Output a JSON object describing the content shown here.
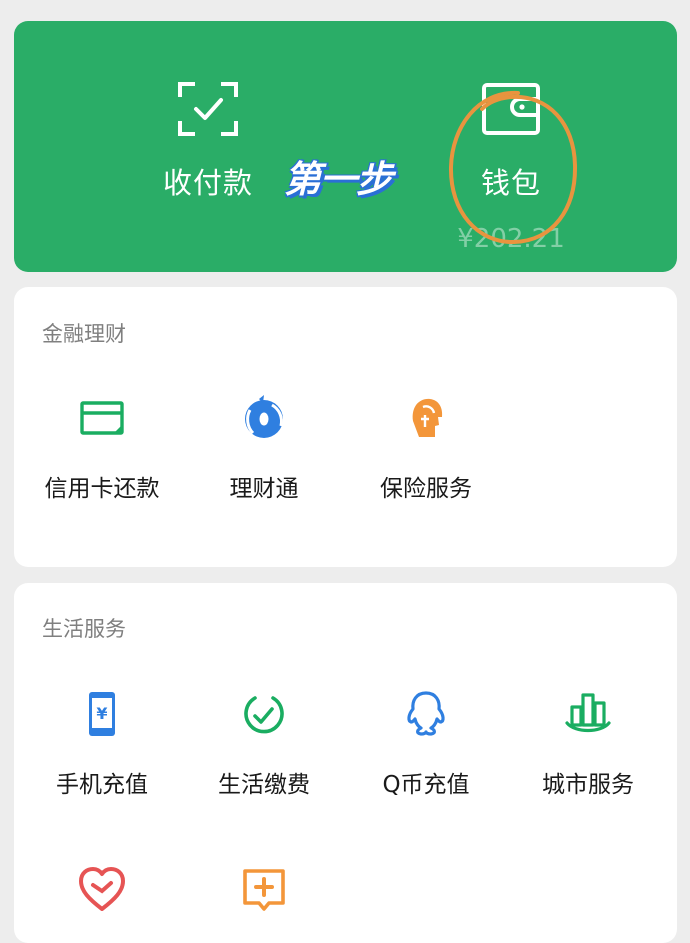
{
  "hero": {
    "pay_label": "收付款",
    "wallet_label": "钱包",
    "balance": "¥202.21",
    "annotation": "第一步"
  },
  "finance": {
    "title": "金融理财",
    "items": [
      {
        "label": "信用卡还款",
        "icon": "credit-card-icon"
      },
      {
        "label": "理财通",
        "icon": "wealth-icon"
      },
      {
        "label": "保险服务",
        "icon": "insurance-icon"
      }
    ]
  },
  "life": {
    "title": "生活服务",
    "items": [
      {
        "label": "手机充值",
        "icon": "phone-topup-icon"
      },
      {
        "label": "生活缴费",
        "icon": "utility-bill-icon"
      },
      {
        "label": "Q币充值",
        "icon": "qq-coin-icon"
      },
      {
        "label": "城市服务",
        "icon": "city-service-icon"
      },
      {
        "label": "",
        "icon": "charity-heart-icon"
      },
      {
        "label": "",
        "icon": "medical-plus-icon"
      }
    ]
  },
  "colors": {
    "hero_green": "#2aad67",
    "icon_green": "#1aad61",
    "icon_blue": "#2f7fe0",
    "icon_orange": "#f3963a",
    "icon_red": "#e65454",
    "annotation_circle": "#e8943f"
  }
}
